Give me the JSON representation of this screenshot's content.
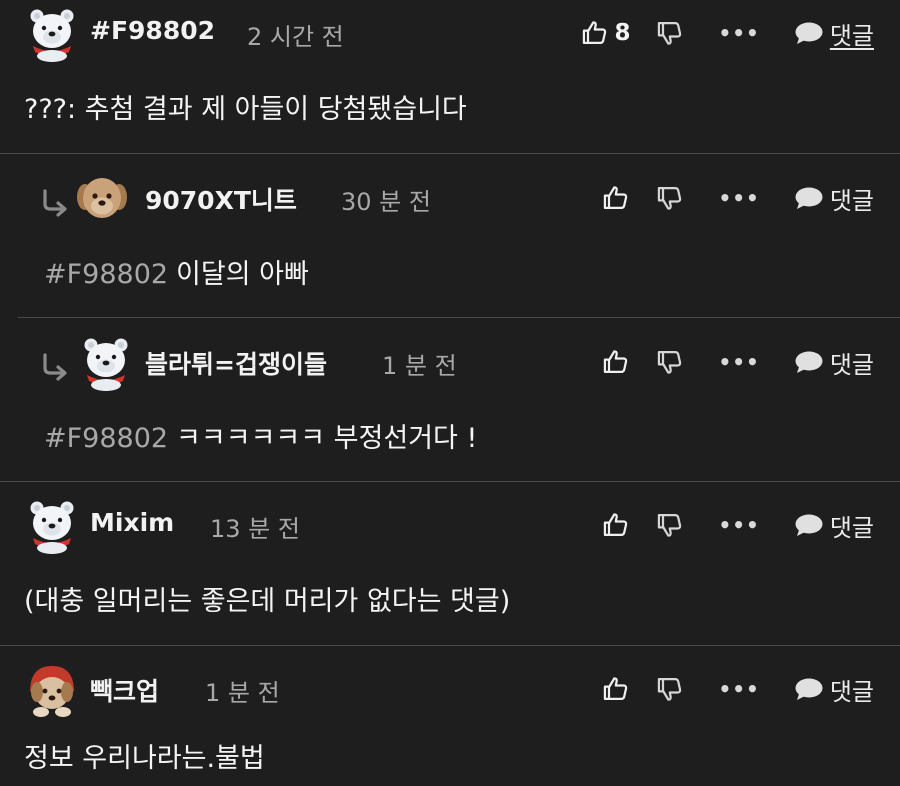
{
  "comments": [
    {
      "nickname": "#F98802",
      "time": "2 시간 전",
      "text": "???: 추첨 결과 제 아들이 당첨됐습니다",
      "likes": "8",
      "reply_label": "댓글",
      "avatar": "polar-bear-avatar"
    },
    {
      "nickname": "9070XT니트",
      "time": "30 분 전",
      "mention": "#F98802",
      "text": "이달의 아빠",
      "reply_label": "댓글",
      "avatar": "puppy-avatar"
    },
    {
      "nickname": "블라튀=겁쟁이들",
      "time": "1 분 전",
      "mention": "#F98802",
      "text": "ㅋㅋㅋㅋㅋㅋ 부정선거다 !",
      "reply_label": "댓글",
      "avatar": "polar-bear-avatar"
    },
    {
      "nickname": "Mixim",
      "time": "13 분 전",
      "text": "(대충 일머리는 좋은데 머리가 없다는 댓글)",
      "reply_label": "댓글",
      "avatar": "polar-bear-avatar"
    },
    {
      "nickname": "빽크업",
      "time": "1 분 전",
      "text": "정보 우리나라는.불법",
      "reply_label": "댓글",
      "avatar": "puppy-red-hood-avatar"
    }
  ],
  "colors": {
    "background": "#1e1e1e",
    "separator": "#4a4a4a",
    "muted_text": "#a8a8a8",
    "primary_text": "#f4f4f4"
  }
}
